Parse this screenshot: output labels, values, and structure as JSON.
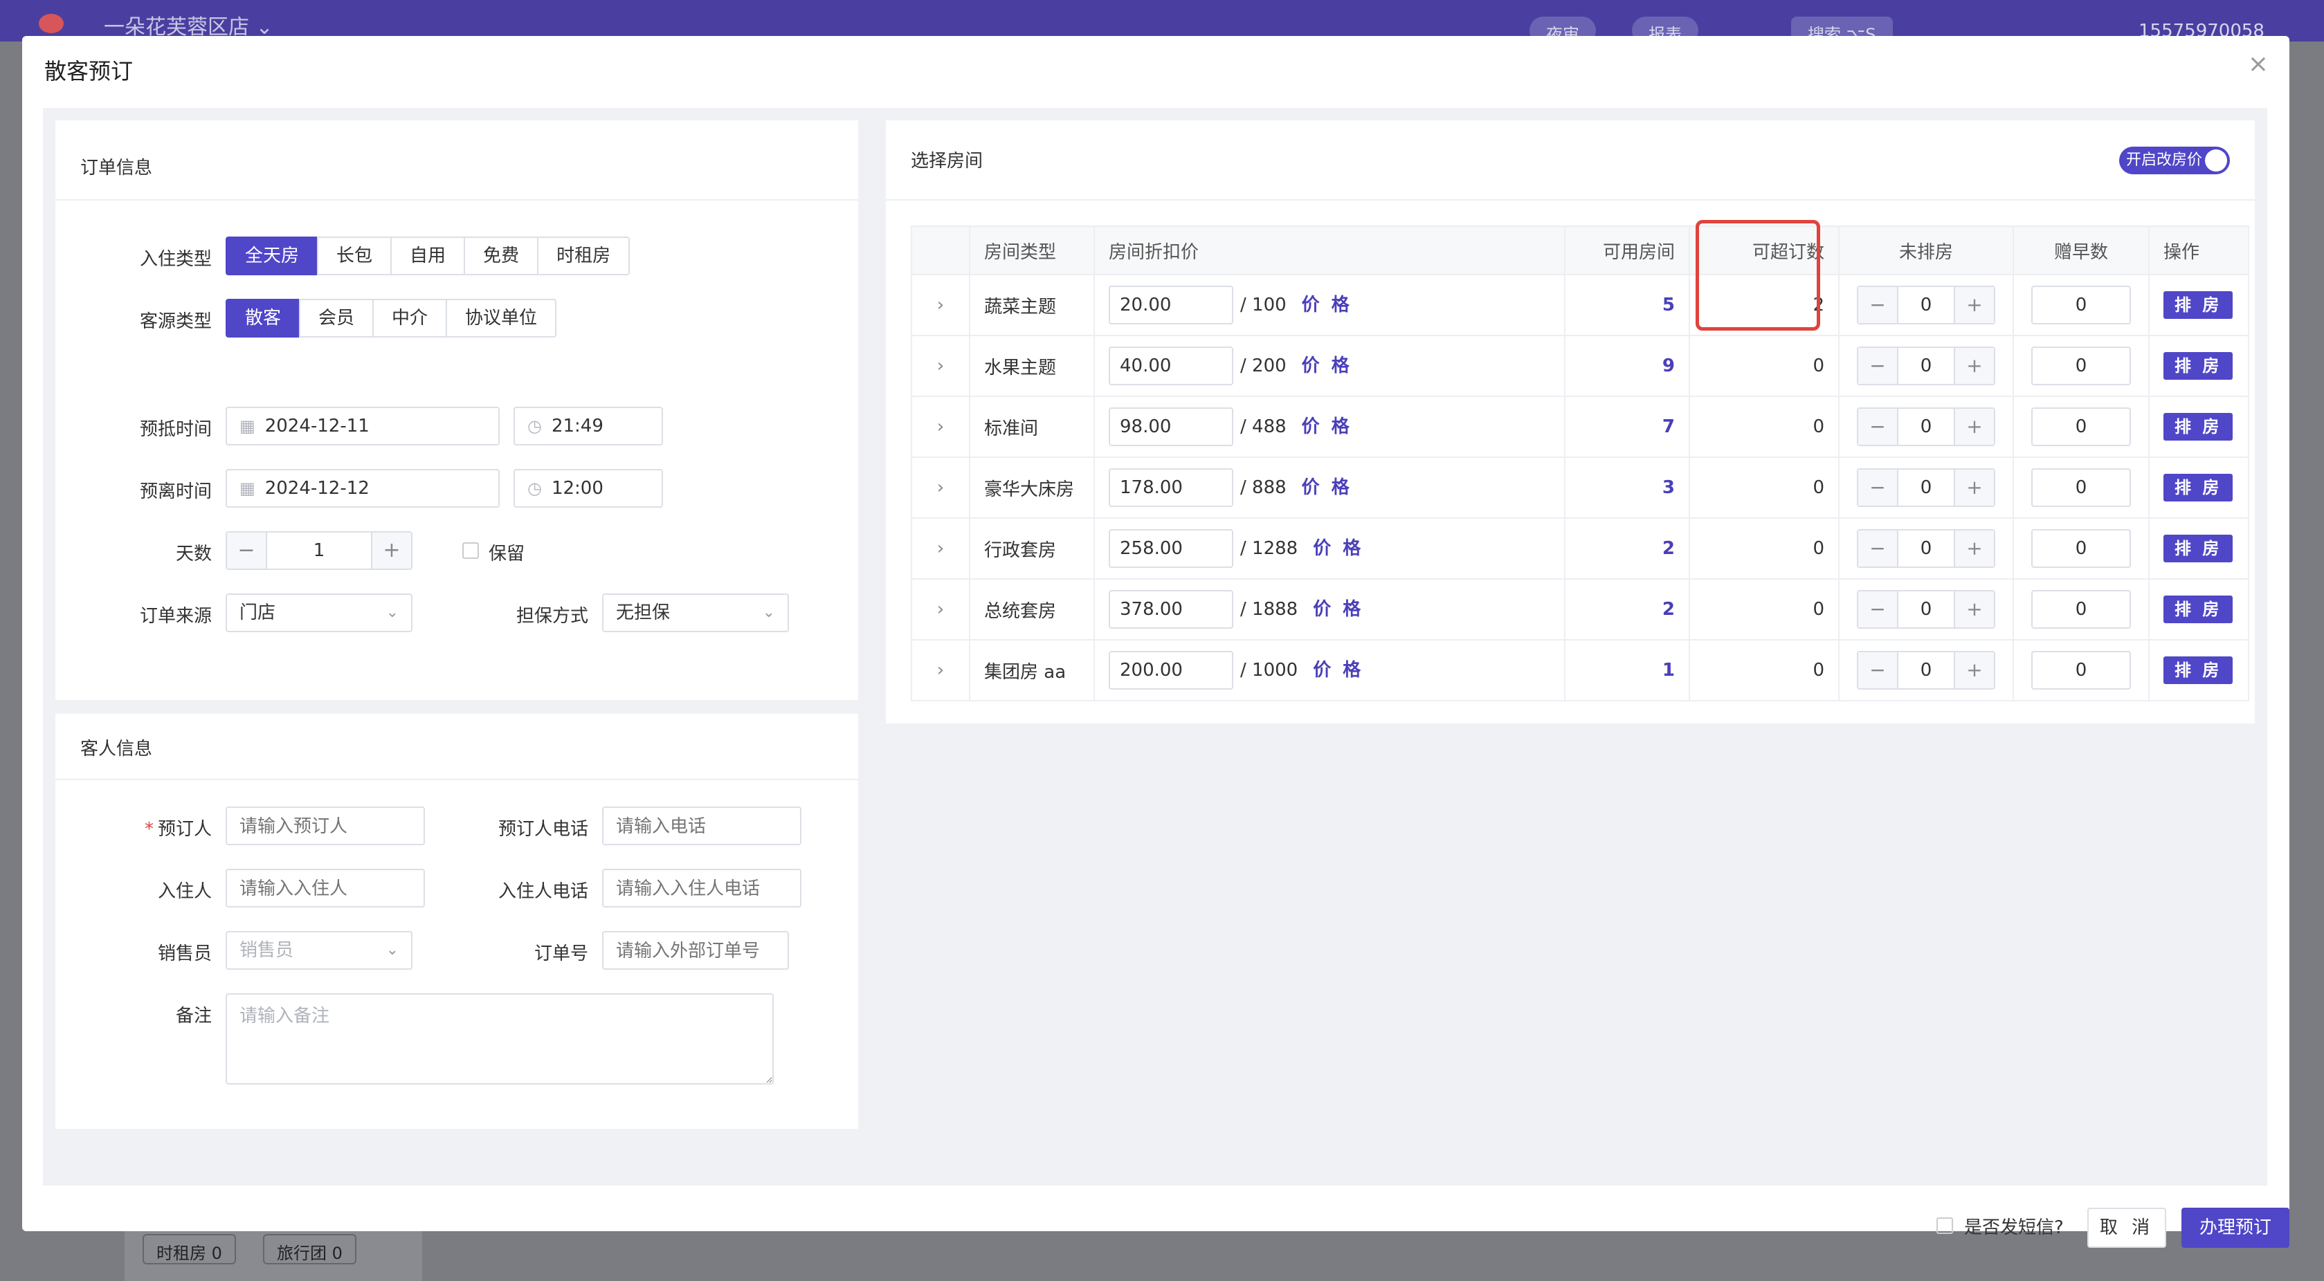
{
  "background": {
    "store_name": "一朵花芙蓉区店 ⌄",
    "night_audit": "夜审",
    "report": "报表",
    "search": "搜索 ⌥S",
    "phone": "15575970058",
    "bottom_tags": [
      "时租房 0",
      "旅行团 0"
    ]
  },
  "modal": {
    "title": "散客预订",
    "close": "×"
  },
  "order": {
    "section_title": "订单信息",
    "stay_type_label": "入住类型",
    "stay_types": [
      "全天房",
      "长包",
      "自用",
      "免费",
      "时租房"
    ],
    "stay_type_selected": "全天房",
    "guest_source_label": "客源类型",
    "guest_sources": [
      "散客",
      "会员",
      "中介",
      "协议单位"
    ],
    "guest_source_selected": "散客",
    "arrival_label": "预抵时间",
    "arrival_date": "2024-12-11",
    "arrival_time": "21:49",
    "departure_label": "预离时间",
    "departure_date": "2024-12-12",
    "departure_time": "12:00",
    "days_label": "天数",
    "days_value": "1",
    "retain_label": "保留",
    "order_source_label": "订单来源",
    "order_source_value": "门店",
    "guarantee_label": "担保方式",
    "guarantee_value": "无担保"
  },
  "guest": {
    "section_title": "客人信息",
    "booker_label": "预订人",
    "booker_placeholder": "请输入预订人",
    "booker_phone_label": "预订人电话",
    "booker_phone_placeholder": "请输入电话",
    "occupant_label": "入住人",
    "occupant_placeholder": "请输入入住人",
    "occupant_phone_label": "入住人电话",
    "occupant_phone_placeholder": "请输入入住人电话",
    "sales_label": "销售员",
    "sales_placeholder": "销售员",
    "order_no_label": "订单号",
    "order_no_placeholder": "请输入外部订单号",
    "remark_label": "备注",
    "remark_placeholder": "请输入备注"
  },
  "rooms": {
    "section_title": "选择房间",
    "toggle_label": "开启改房价",
    "columns": [
      "房间类型",
      "房间折扣价",
      "可用房间",
      "可超订数",
      "未排房",
      "赠早数",
      "操作"
    ],
    "price_link": "价 格",
    "assign_label": "排 房",
    "rows": [
      {
        "type": "蔬菜主题",
        "discount": "20.00",
        "base": "/ 100",
        "available": "5",
        "overbook": "2",
        "unassigned": "0",
        "breakfast": "0"
      },
      {
        "type": "水果主题",
        "discount": "40.00",
        "base": "/ 200",
        "available": "9",
        "overbook": "0",
        "unassigned": "0",
        "breakfast": "0"
      },
      {
        "type": "标准间",
        "discount": "98.00",
        "base": "/ 488",
        "available": "7",
        "overbook": "0",
        "unassigned": "0",
        "breakfast": "0"
      },
      {
        "type": "豪华大床房",
        "discount": "178.00",
        "base": "/ 888",
        "available": "3",
        "overbook": "0",
        "unassigned": "0",
        "breakfast": "0"
      },
      {
        "type": "行政套房",
        "discount": "258.00",
        "base": "/ 1288",
        "available": "2",
        "overbook": "0",
        "unassigned": "0",
        "breakfast": "0"
      },
      {
        "type": "总统套房",
        "discount": "378.00",
        "base": "/ 1888",
        "available": "2",
        "overbook": "0",
        "unassigned": "0",
        "breakfast": "0"
      },
      {
        "type": "集团房 aa",
        "discount": "200.00",
        "base": "/ 1000",
        "available": "1",
        "overbook": "0",
        "unassigned": "0",
        "breakfast": "0"
      }
    ]
  },
  "footer": {
    "sms_label": "是否发短信?",
    "cancel_label": "取 消",
    "submit_label": "办理预订"
  },
  "colors": {
    "primary": "#5046c8",
    "highlight": "#e0433d"
  }
}
